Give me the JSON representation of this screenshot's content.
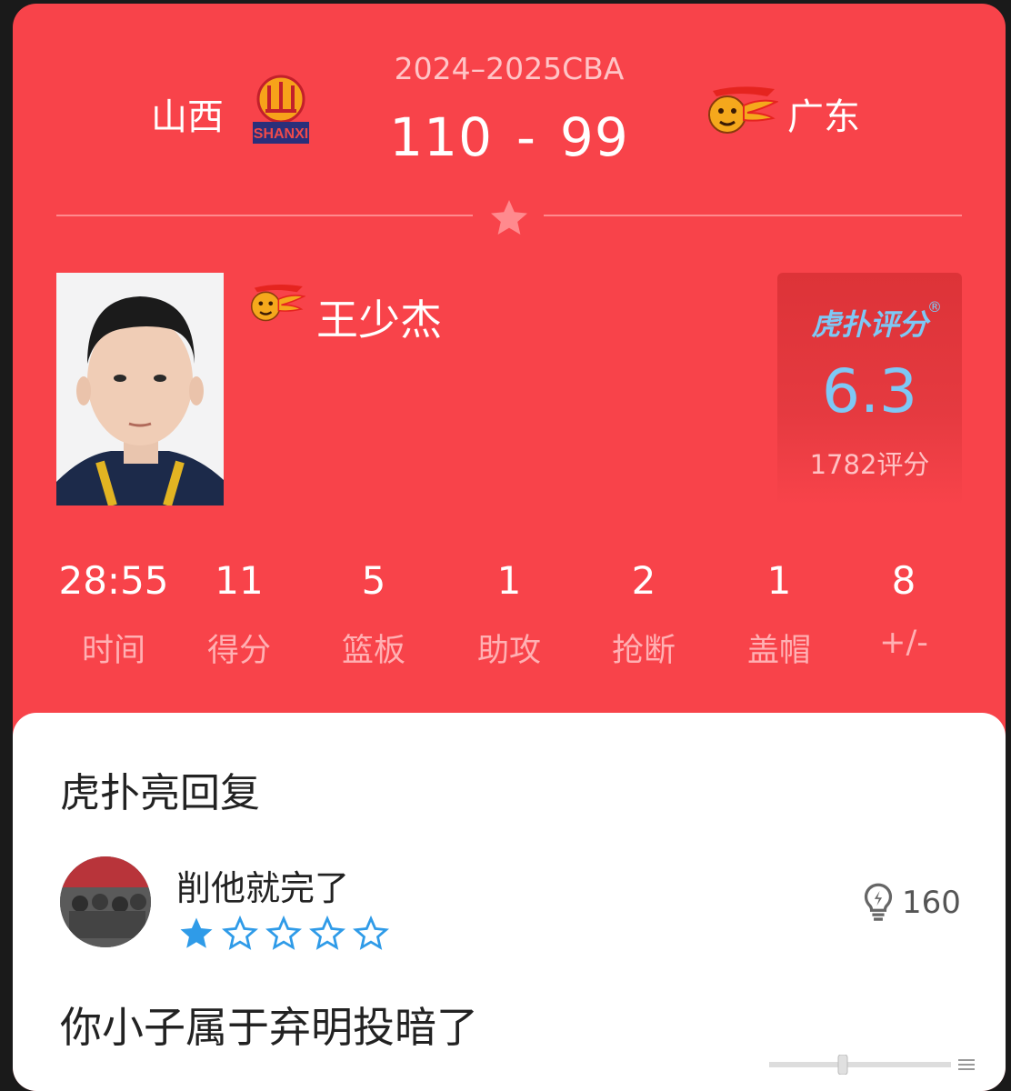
{
  "match": {
    "season": "2024–2025CBA",
    "home_team": "山西",
    "away_team": "广东",
    "home_score": "110",
    "separator": "-",
    "away_score": "99"
  },
  "player": {
    "name": "王少杰"
  },
  "rating": {
    "brand": "虎扑评分",
    "registered": "®",
    "value": "6.3",
    "count": "1782评分"
  },
  "stats": [
    {
      "value": "28:55",
      "label": "时间"
    },
    {
      "value": "11",
      "label": "得分"
    },
    {
      "value": "5",
      "label": "篮板"
    },
    {
      "value": "1",
      "label": "助攻"
    },
    {
      "value": "2",
      "label": "抢断"
    },
    {
      "value": "1",
      "label": "盖帽"
    },
    {
      "value": "8",
      "label": "+/-"
    }
  ],
  "reply": {
    "title": "虎扑亮回复",
    "comment": "削他就完了",
    "star_rating": 1,
    "star_max": 5,
    "likes": "160",
    "body": "你小子属于弃明投暗了"
  },
  "colors": {
    "primary_red": "#f8434a",
    "rating_blue": "#7ec8f5",
    "star_blue": "#2f9be8"
  }
}
